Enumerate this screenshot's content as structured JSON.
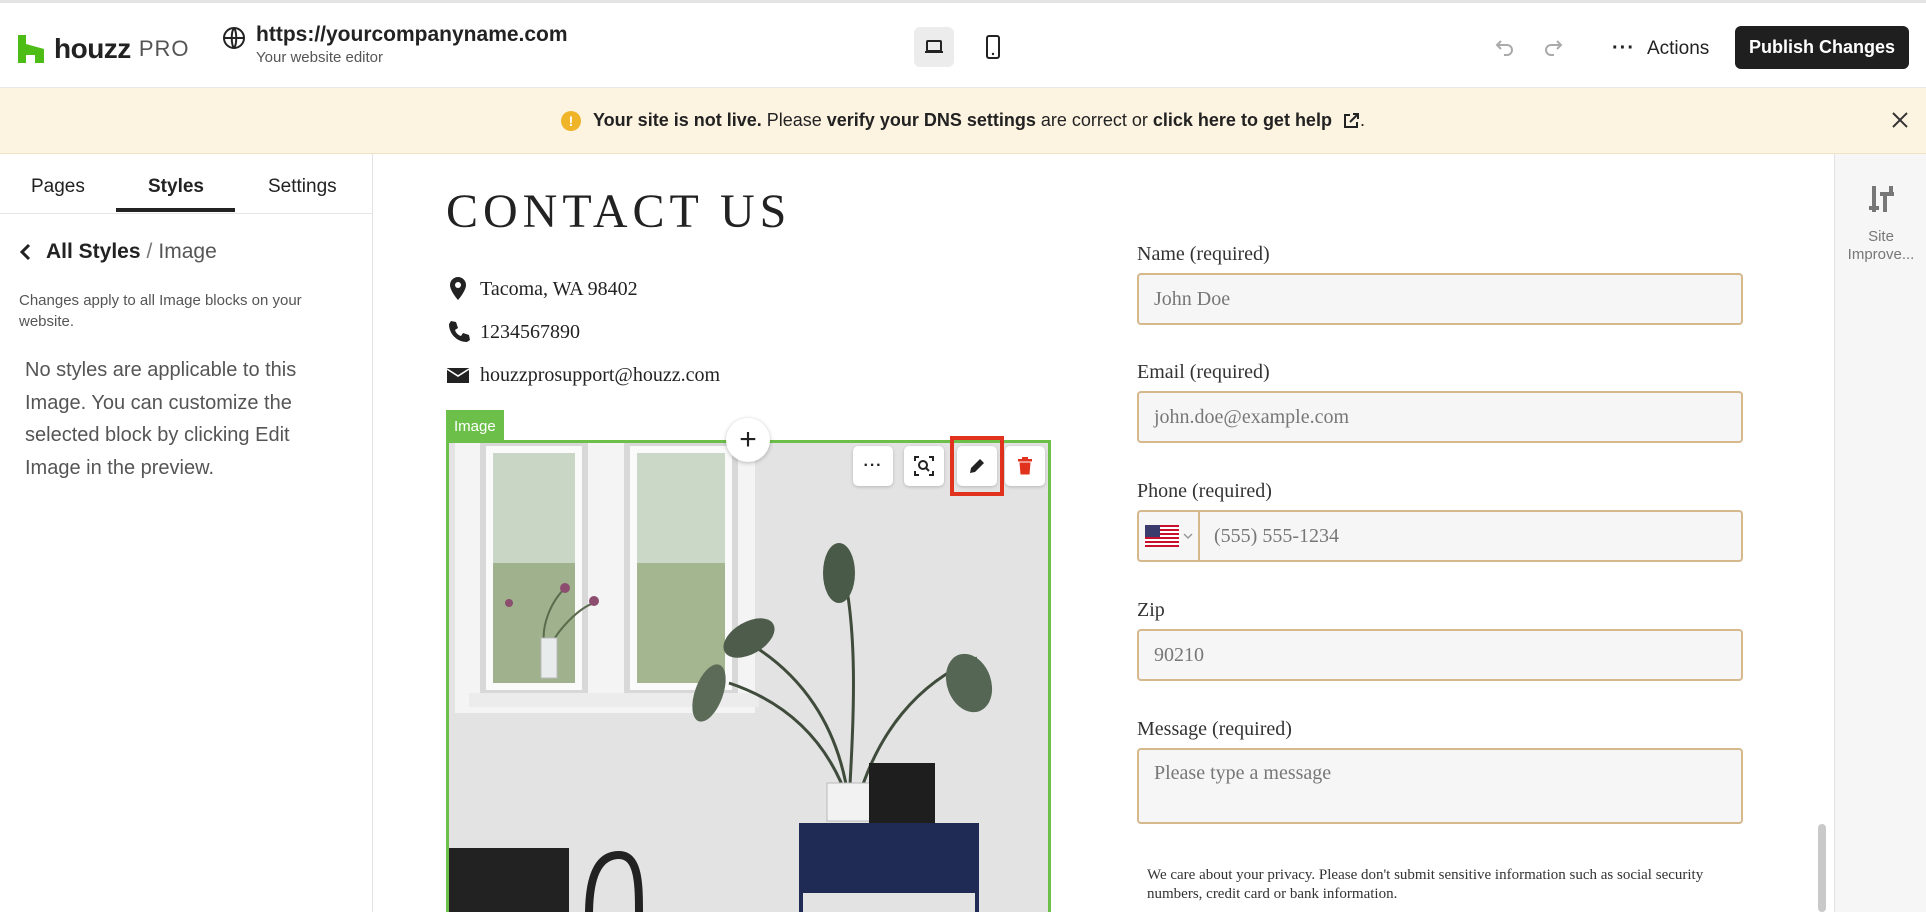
{
  "app": {
    "logo_word": "houzz",
    "logo_pro": "PRO",
    "brand_color": "#4dbc15",
    "site_url": "https://yourcompanyname.com",
    "site_sub": "Your website editor",
    "actions_label": "Actions",
    "publish_label": "Publish Changes"
  },
  "banner": {
    "warn_glyph": "!",
    "part1": "Your site is not live.",
    "part2": " Please ",
    "part3": "verify your DNS settings",
    "part4": " are correct or ",
    "part5": "click here to get help",
    "part6": "."
  },
  "sidebar": {
    "tabs": [
      "Pages",
      "Styles",
      "Settings"
    ],
    "active_tab": "Styles",
    "crumb_root": "All Styles",
    "crumb_sep": "/",
    "crumb_current": "Image",
    "note": "Changes apply to all Image blocks on your website.",
    "message": "No styles are applicable to this Image. You can customize the selected block by clicking Edit Image in the preview."
  },
  "rail": {
    "label": "Site Improve..."
  },
  "page": {
    "title": "CONTACT US",
    "address": "Tacoma, WA 98402",
    "phone": "1234567890",
    "email": "houzzprosupport@houzz.com",
    "image_tag": "Image",
    "add_glyph": "+",
    "tools": [
      "more-icon",
      "zoom-icon",
      "edit-icon",
      "delete-icon"
    ],
    "highlight_color": "#e0321c",
    "selection_color": "#6cc04a"
  },
  "form": {
    "name_label": "Name (required)",
    "name_placeholder": "John Doe",
    "email_label": "Email (required)",
    "email_placeholder": "john.doe@example.com",
    "phone_label": "Phone (required)",
    "phone_placeholder": "(555) 555-1234",
    "zip_label": "Zip",
    "zip_value": "90210",
    "message_label": "Message (required)",
    "message_placeholder": "Please type a message",
    "privacy": "We care about your privacy. Please don't submit sensitive information such as social security numbers, credit card or bank information."
  }
}
